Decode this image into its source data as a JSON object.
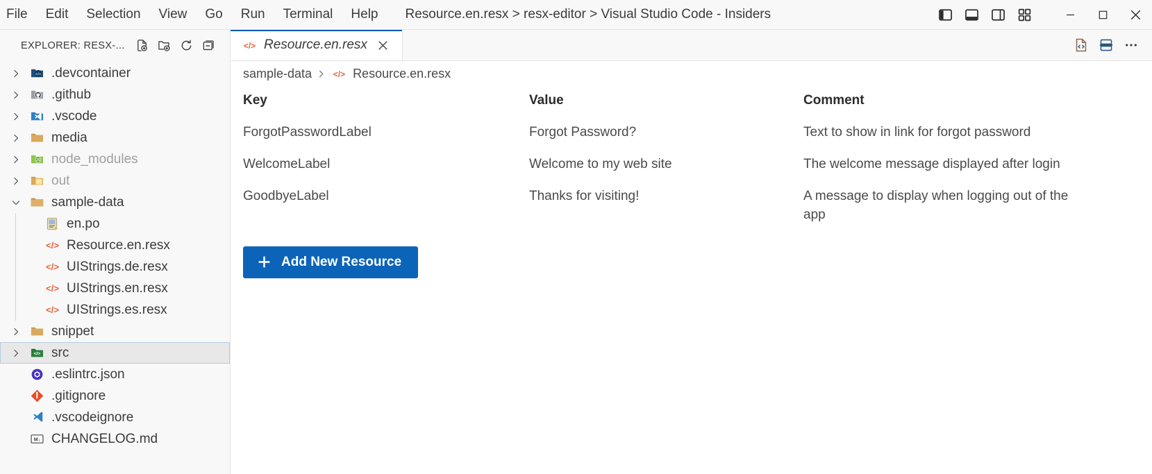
{
  "window": {
    "title": "Resource.en.resx > resx-editor > Visual Studio Code - Insiders",
    "menus": [
      "File",
      "Edit",
      "Selection",
      "View",
      "Go",
      "Run",
      "Terminal",
      "Help"
    ],
    "layout_controls": [
      {
        "name": "toggle-primary-sidebar",
        "label": "Toggle Primary Side Bar"
      },
      {
        "name": "toggle-panel",
        "label": "Toggle Panel"
      },
      {
        "name": "toggle-secondary-sidebar",
        "label": "Toggle Secondary Side Bar"
      },
      {
        "name": "customize-layout",
        "label": "Customize Layout"
      }
    ],
    "controls": [
      {
        "name": "minimize",
        "label": "Minimize"
      },
      {
        "name": "maximize",
        "label": "Restore"
      },
      {
        "name": "close",
        "label": "Close"
      }
    ]
  },
  "sidebar": {
    "title": "EXPLORER: RESX-...",
    "actions": [
      {
        "name": "new-file",
        "label": "New File..."
      },
      {
        "name": "new-folder",
        "label": "New Folder..."
      },
      {
        "name": "refresh-explorer",
        "label": "Refresh Explorer"
      },
      {
        "name": "collapse-folders",
        "label": "Collapse Folders in Explorer"
      }
    ],
    "items": [
      {
        "label": ".devcontainer",
        "type": "folder",
        "icon": "folder-devcontainer-icon",
        "expanded": false,
        "depth": 0,
        "dimmed": false,
        "selected": false
      },
      {
        "label": ".github",
        "type": "folder",
        "icon": "folder-github-icon",
        "expanded": false,
        "depth": 0,
        "dimmed": false,
        "selected": false
      },
      {
        "label": ".vscode",
        "type": "folder",
        "icon": "folder-vscode-icon",
        "expanded": false,
        "depth": 0,
        "dimmed": false,
        "selected": false
      },
      {
        "label": "media",
        "type": "folder",
        "icon": "folder-icon",
        "expanded": false,
        "depth": 0,
        "dimmed": false,
        "selected": false
      },
      {
        "label": "node_modules",
        "type": "folder",
        "icon": "folder-node-icon",
        "expanded": false,
        "depth": 0,
        "dimmed": true,
        "selected": false
      },
      {
        "label": "out",
        "type": "folder",
        "icon": "folder-out-icon",
        "expanded": false,
        "depth": 0,
        "dimmed": true,
        "selected": false
      },
      {
        "label": "sample-data",
        "type": "folder",
        "icon": "folder-open-icon",
        "expanded": true,
        "depth": 0,
        "dimmed": false,
        "selected": false
      },
      {
        "label": "en.po",
        "type": "file",
        "icon": "po-file-icon",
        "expanded": null,
        "depth": 1,
        "dimmed": false,
        "selected": false
      },
      {
        "label": "Resource.en.resx",
        "type": "file",
        "icon": "resx-file-icon",
        "expanded": null,
        "depth": 1,
        "dimmed": false,
        "selected": false
      },
      {
        "label": "UIStrings.de.resx",
        "type": "file",
        "icon": "resx-file-icon",
        "expanded": null,
        "depth": 1,
        "dimmed": false,
        "selected": false
      },
      {
        "label": "UIStrings.en.resx",
        "type": "file",
        "icon": "resx-file-icon",
        "expanded": null,
        "depth": 1,
        "dimmed": false,
        "selected": false
      },
      {
        "label": "UIStrings.es.resx",
        "type": "file",
        "icon": "resx-file-icon",
        "expanded": null,
        "depth": 1,
        "dimmed": false,
        "selected": false
      },
      {
        "label": "snippet",
        "type": "folder",
        "icon": "folder-icon",
        "expanded": false,
        "depth": 0,
        "dimmed": false,
        "selected": false
      },
      {
        "label": "src",
        "type": "folder",
        "icon": "folder-src-icon",
        "expanded": false,
        "depth": 0,
        "dimmed": false,
        "selected": true
      },
      {
        "label": ".eslintrc.json",
        "type": "file",
        "icon": "eslint-file-icon",
        "expanded": null,
        "depth": 0,
        "dimmed": false,
        "selected": false
      },
      {
        "label": ".gitignore",
        "type": "file",
        "icon": "git-file-icon",
        "expanded": null,
        "depth": 0,
        "dimmed": false,
        "selected": false
      },
      {
        "label": ".vscodeignore",
        "type": "file",
        "icon": "vscode-file-icon",
        "expanded": null,
        "depth": 0,
        "dimmed": false,
        "selected": false
      },
      {
        "label": "CHANGELOG.md",
        "type": "file",
        "icon": "markdown-file-icon",
        "expanded": null,
        "depth": 0,
        "dimmed": false,
        "selected": false
      }
    ]
  },
  "editor": {
    "tabs": [
      {
        "label": "Resource.en.resx",
        "icon": "resx-file-icon",
        "active": true,
        "preview": true,
        "close_label": "Close"
      }
    ],
    "actions": [
      {
        "name": "reopen-with-text-editor",
        "label": "Open With Text Editor"
      },
      {
        "name": "split-editor",
        "label": "Split Editor"
      },
      {
        "name": "more-actions",
        "label": "More Actions..."
      }
    ],
    "breadcrumbs": [
      "sample-data",
      "Resource.en.resx"
    ],
    "breadcrumb_icon": "resx-file-icon"
  },
  "resx": {
    "columns": [
      "Key",
      "Value",
      "Comment"
    ],
    "rows": [
      {
        "key": "ForgotPasswordLabel",
        "value": "Forgot Password?",
        "comment": "Text to show in link for forgot password"
      },
      {
        "key": "WelcomeLabel",
        "value": "Welcome to my web site",
        "comment": "The welcome message displayed after login"
      },
      {
        "key": "GoodbyeLabel",
        "value": "Thanks for visiting!",
        "comment": "A message to display when logging out of the app"
      }
    ],
    "add_button": {
      "label": "Add New Resource",
      "icon": "plus-icon"
    }
  },
  "colors": {
    "accent_blue": "#0c64b9",
    "tab_active_border": "#005fb8",
    "resx_icon_orange": "#e8623a",
    "background": "#f8f8f8",
    "editor_background": "#ffffff",
    "selection_background": "#e8e8e8",
    "selection_border": "#b3cde4"
  }
}
